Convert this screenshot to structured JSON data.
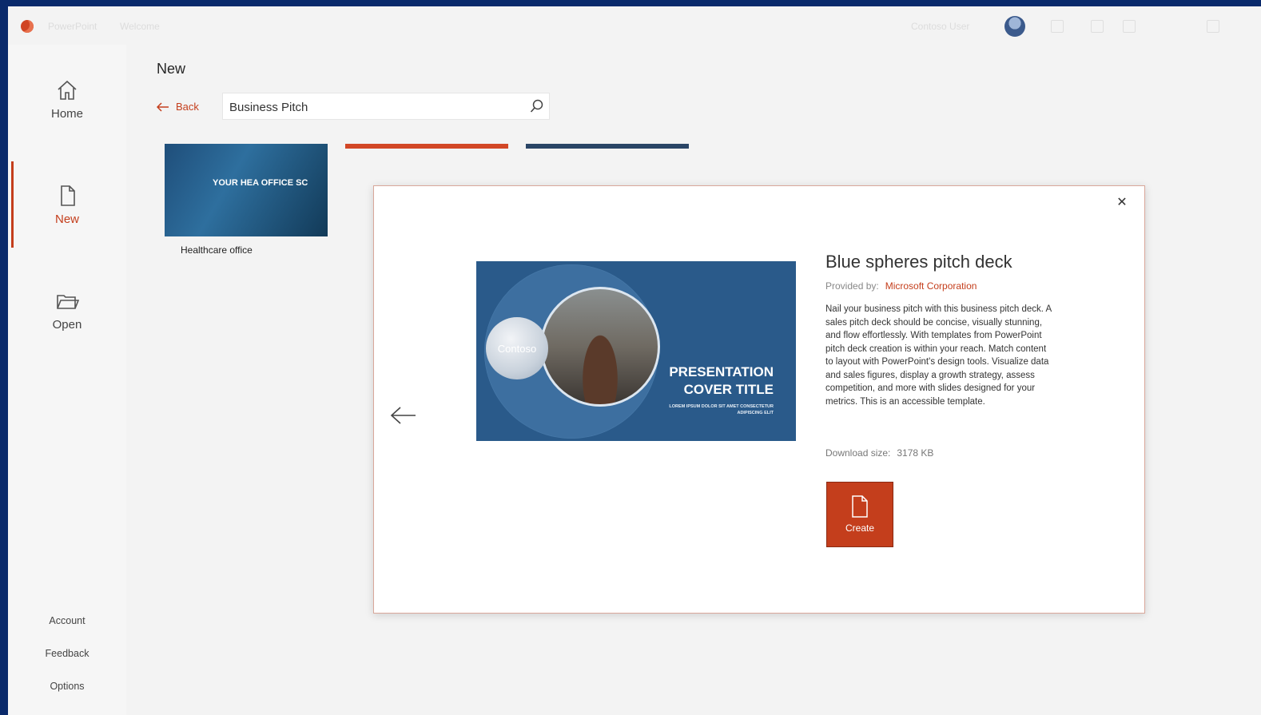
{
  "titlebar": {
    "app_name": "PowerPoint",
    "doc_name": "Welcome",
    "user_name": "Contoso User"
  },
  "leftnav": {
    "items": [
      {
        "label": "Home",
        "icon": "home-icon"
      },
      {
        "label": "New",
        "icon": "new-file-icon",
        "active": true
      },
      {
        "label": "Open",
        "icon": "folder-open-icon"
      }
    ],
    "footer": [
      {
        "label": "Account"
      },
      {
        "label": "Feedback"
      },
      {
        "label": "Options"
      }
    ]
  },
  "main": {
    "title": "New",
    "back_label": "Back",
    "search": {
      "value": "Business Pitch"
    },
    "templates": [
      {
        "label": "Healthcare office",
        "thumb_text": "YOUR HEA OFFICE SC"
      }
    ]
  },
  "dialog": {
    "template_title": "Blue spheres pitch deck",
    "provided_by_label": "Provided by:",
    "provider": "Microsoft Corporation",
    "description": "Nail your business pitch with this business pitch deck. A sales pitch deck should be concise, visually stunning, and flow effortlessly. With templates from PowerPoint pitch deck creation is within your reach. Match content to layout with PowerPoint's design tools. Visualize data and sales figures, display a growth strategy, assess competition, and more with slides designed for your metrics. This is an accessible template.",
    "download_label": "Download size:",
    "download_size": "3178 KB",
    "create_label": "Create",
    "preview": {
      "brand": "Contoso",
      "cover_title_line1": "PRESENTATION",
      "cover_title_line2": "COVER TITLE",
      "cover_sub": "LOREM IPSUM DOLOR SIT AMET CONSECTETUR ADIPISCING ELIT"
    }
  },
  "colors": {
    "accent": "#c43e1c",
    "preview_bg": "#2a5a8a",
    "frame": "#0a2a6b"
  }
}
